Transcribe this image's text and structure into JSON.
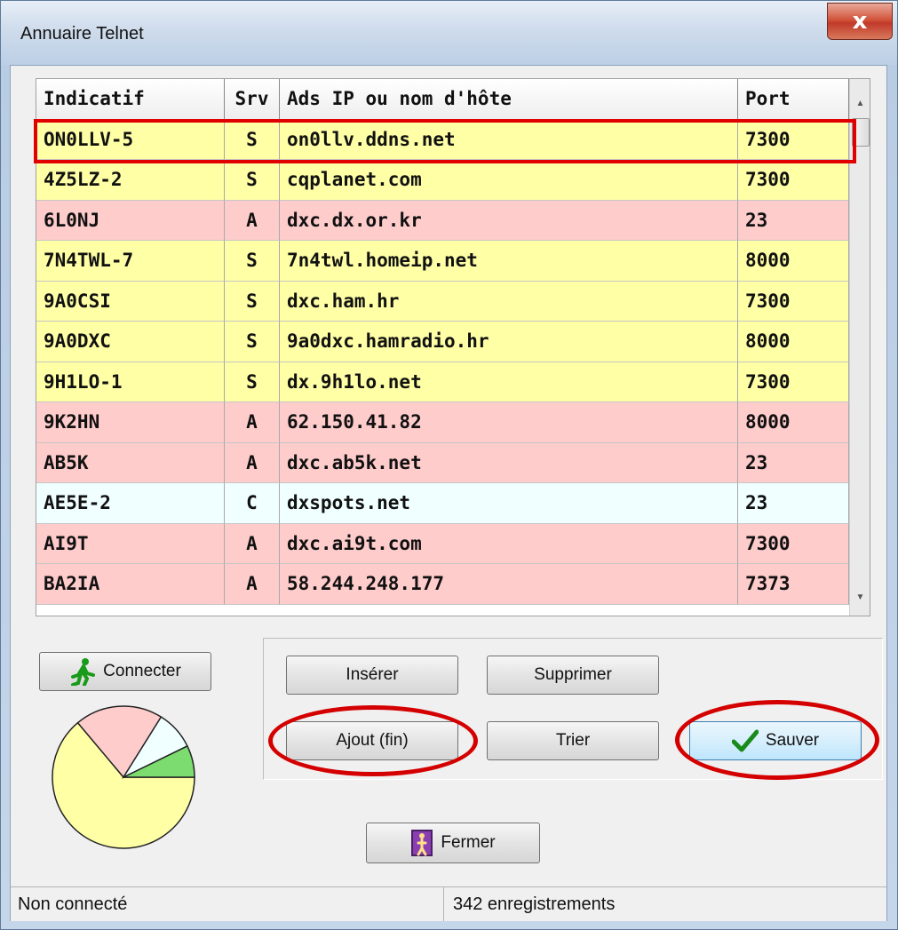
{
  "window": {
    "title": "Annuaire Telnet",
    "close_glyph": "x"
  },
  "table": {
    "columns": [
      "Indicatif",
      "Srv",
      "Ads IP ou nom d'hôte",
      "Port"
    ],
    "rows": [
      {
        "callsign": "ON0LLV-5",
        "srv": "S",
        "host": "on0llv.ddns.net",
        "port": "7300",
        "color": "#ffffa6"
      },
      {
        "callsign": "4Z5LZ-2",
        "srv": "S",
        "host": "cqplanet.com",
        "port": "7300",
        "color": "#ffffa6"
      },
      {
        "callsign": "6L0NJ",
        "srv": "A",
        "host": "dxc.dx.or.kr",
        "port": "23",
        "color": "#ffcccc"
      },
      {
        "callsign": "7N4TWL-7",
        "srv": "S",
        "host": "7n4twl.homeip.net",
        "port": "8000",
        "color": "#ffffa6"
      },
      {
        "callsign": "9A0CSI",
        "srv": "S",
        "host": "dxc.ham.hr",
        "port": "7300",
        "color": "#ffffa6"
      },
      {
        "callsign": "9A0DXC",
        "srv": "S",
        "host": "9a0dxc.hamradio.hr",
        "port": "8000",
        "color": "#ffffa6"
      },
      {
        "callsign": "9H1LO-1",
        "srv": "S",
        "host": "dx.9h1lo.net",
        "port": "7300",
        "color": "#ffffa6"
      },
      {
        "callsign": "9K2HN",
        "srv": "A",
        "host": "62.150.41.82",
        "port": "8000",
        "color": "#ffcccc"
      },
      {
        "callsign": "AB5K",
        "srv": "A",
        "host": "dxc.ab5k.net",
        "port": "23",
        "color": "#ffcccc"
      },
      {
        "callsign": "AE5E-2",
        "srv": "C",
        "host": "dxspots.net",
        "port": "23",
        "color": "#f0ffff"
      },
      {
        "callsign": "AI9T",
        "srv": "A",
        "host": "dxc.ai9t.com",
        "port": "7300",
        "color": "#ffcccc"
      },
      {
        "callsign": "BA2IA",
        "srv": "A",
        "host": "58.244.248.177",
        "port": "7373",
        "color": "#ffcccc"
      }
    ]
  },
  "buttons": {
    "connect": "Connecter",
    "insert": "Insérer",
    "delete": "Supprimer",
    "append": "Ajout (fin)",
    "sort": "Trier",
    "save": "Sauver",
    "close": "Fermer"
  },
  "pie": {
    "colors": [
      "#ffffa6",
      "#ffcccc",
      "#f0ffff",
      "#7ddc6f"
    ],
    "icon": "pie-chart-icon"
  },
  "status": {
    "connection": "Non connecté",
    "records": "342 enregistrements"
  },
  "icons": {
    "connect": "running-man-icon",
    "save": "checkmark-icon",
    "close": "door-exit-icon"
  }
}
